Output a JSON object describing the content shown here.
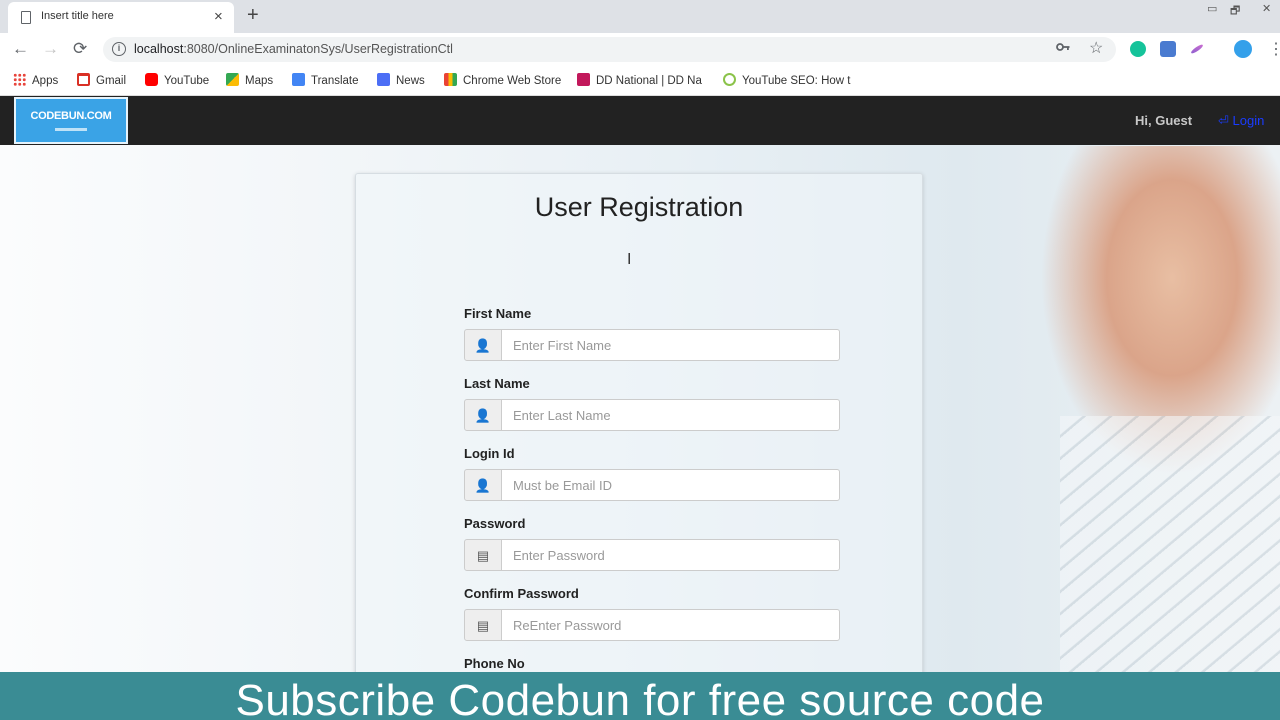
{
  "browser": {
    "tab": {
      "title": "Insert title here",
      "close_glyph": "×"
    },
    "new_tab_glyph": "+",
    "window_controls": [
      "▭",
      "🗗",
      "✕"
    ],
    "nav": {
      "back": "←",
      "forward": "→",
      "reload": "⟳"
    },
    "url": {
      "host": "localhost",
      "rest": ":8080/OnlineExaminatonSys/UserRegistrationCtl"
    },
    "omni_icons": {
      "key": "key-icon",
      "star": "☆"
    },
    "extensions": [
      {
        "name": "grammarly-icon",
        "color": "#15c39a"
      },
      {
        "name": "profile-ext-icon",
        "color": "#4a7bd0"
      },
      {
        "name": "pen-icon",
        "color": "#8a5fd0"
      },
      {
        "name": "avatar",
        "color": "#34a0ea"
      }
    ],
    "menu_glyph": "⋮",
    "bookmarks": [
      {
        "label": "Apps",
        "color": "#e8453c"
      },
      {
        "label": "Gmail",
        "color": "#d93025"
      },
      {
        "label": "YouTube",
        "color": "#ff0000"
      },
      {
        "label": "Maps",
        "color": "#34a853"
      },
      {
        "label": "Translate",
        "color": "#4285f4"
      },
      {
        "label": "News",
        "color": "#4c6ef5"
      },
      {
        "label": "Chrome Web Store",
        "color": "#fbbc05"
      },
      {
        "label": "DD National | DD Na",
        "color": "#c2185b"
      },
      {
        "label": "YouTube SEO: How t",
        "color": "#8bc34a"
      }
    ]
  },
  "site": {
    "brand": {
      "text": "CODEBUN.COM",
      "color": "#3aa3e6"
    },
    "greeting": "Hi, Guest",
    "login_label": "Login"
  },
  "form": {
    "title": "User Registration",
    "fields": [
      {
        "label": "First Name",
        "placeholder": "Enter First Name",
        "icon": "user-icon"
      },
      {
        "label": "Last Name",
        "placeholder": "Enter Last Name",
        "icon": "user-icon"
      },
      {
        "label": "Login Id",
        "placeholder": "Must be Email ID",
        "icon": "user-icon"
      },
      {
        "label": "Password",
        "placeholder": "Enter Password",
        "icon": "list-icon"
      },
      {
        "label": "Confirm Password",
        "placeholder": "ReEnter Password",
        "icon": "list-icon"
      },
      {
        "label": "Phone No"
      }
    ]
  },
  "banner": {
    "text": "Subscribe Codebun for free source code",
    "color": "#3a8c94"
  }
}
